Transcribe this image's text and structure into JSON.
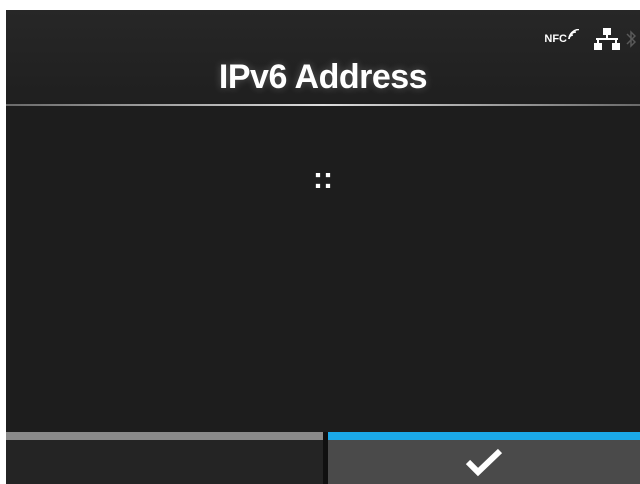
{
  "screen": {
    "title": "IPv6 Address"
  },
  "status_bar": {
    "nfc_label": "NFC",
    "icons": [
      "nfc-icon",
      "network-icon",
      "bluetooth-icon"
    ]
  },
  "main": {
    "address_value": "::"
  },
  "footer": {
    "left_button": {
      "label": "",
      "indicator_color": "#8a8a8a"
    },
    "right_button": {
      "icon": "checkmark-icon",
      "indicator_color": "#1ba8e8"
    }
  }
}
